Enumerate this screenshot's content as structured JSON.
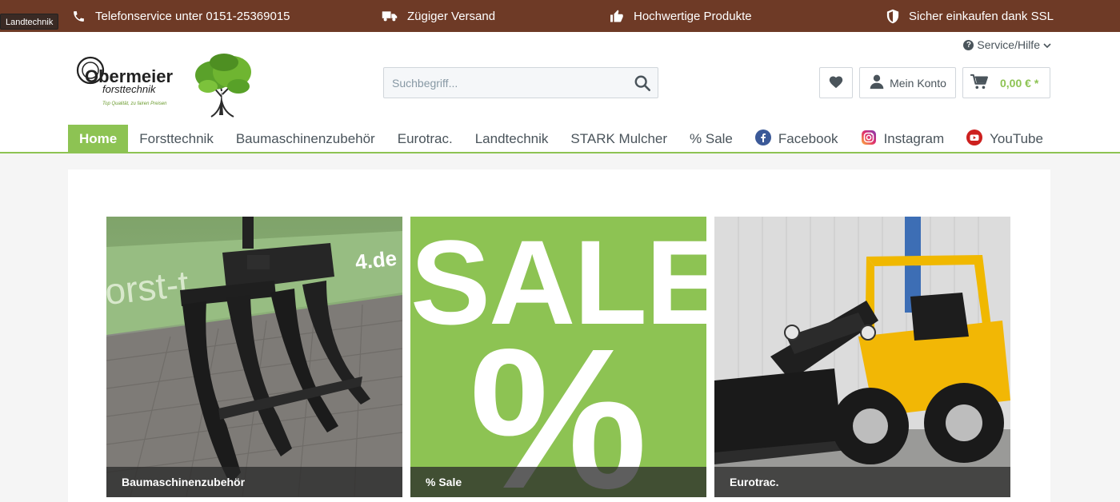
{
  "tooltip": "Landtechnik",
  "topbar": {
    "items": [
      {
        "icon": "phone-icon",
        "label": "Telefonservice unter 0151-25369015"
      },
      {
        "icon": "truck-icon",
        "label": "Zügiger Versand"
      },
      {
        "icon": "thumbs-up-icon",
        "label": "Hochwertige Produkte"
      },
      {
        "icon": "shield-icon",
        "label": "Sicher einkaufen dank SSL"
      }
    ]
  },
  "header": {
    "service_label": "Service/Hilfe",
    "logo_name": "Obermeier",
    "logo_sub": "forsttechnik",
    "logo_tagline": "Top Qualität, zu fairen Preisen",
    "search_placeholder": "Suchbegriff...",
    "account_label": "Mein Konto",
    "cart_amount": "0,00 € *"
  },
  "nav": {
    "items": [
      {
        "label": "Home",
        "active": true
      },
      {
        "label": "Forsttechnik"
      },
      {
        "label": "Baumaschinenzubehör"
      },
      {
        "label": "Eurotrac."
      },
      {
        "label": "Landtechnik"
      },
      {
        "label": "STARK Mulcher"
      },
      {
        "label": "% Sale"
      },
      {
        "label": "Facebook",
        "icon": "facebook-icon"
      },
      {
        "label": "Instagram",
        "icon": "instagram-icon"
      },
      {
        "label": "YouTube",
        "icon": "youtube-icon"
      }
    ]
  },
  "tiles": [
    {
      "caption": "Baumaschinenzubehör",
      "banner_text": "orst-t",
      "banner_suffix": "4.de"
    },
    {
      "caption": "% Sale",
      "big_text": "SALE",
      "big_symbol": "%"
    },
    {
      "caption": "Eurotrac."
    }
  ],
  "colors": {
    "brand_brown": "#6e3a26",
    "accent_green": "#8dc353"
  }
}
